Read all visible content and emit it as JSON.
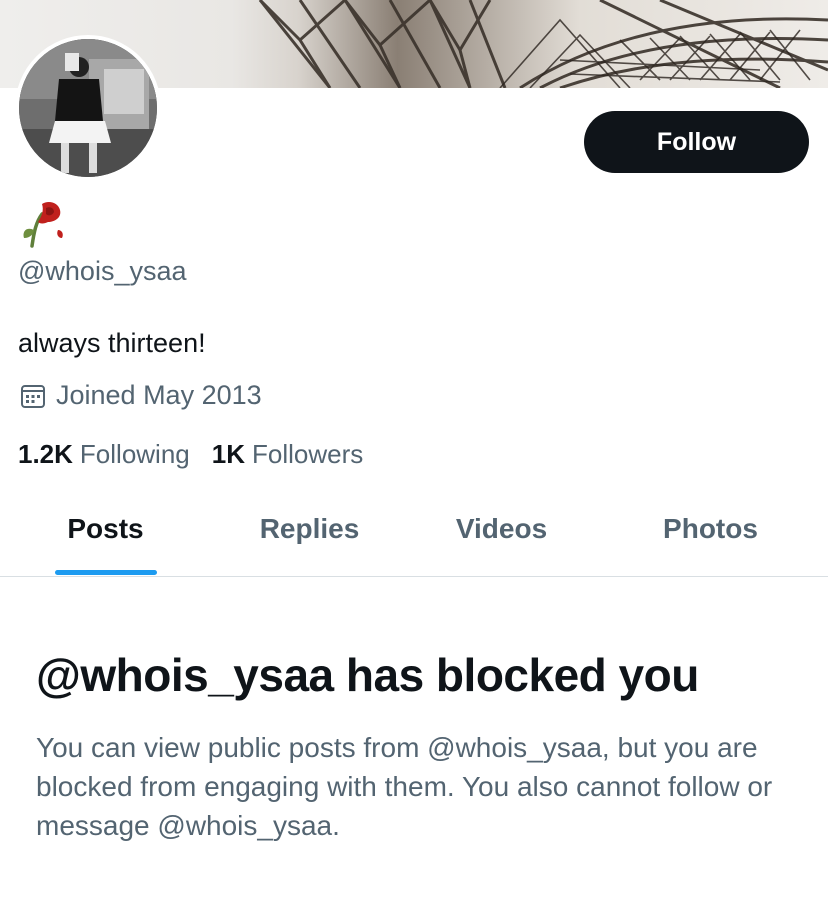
{
  "profile": {
    "handle": "@whois_ysaa",
    "bio": "always thirteen!",
    "joined": "Joined May 2013",
    "name_emoji": "wilted-rose-icon"
  },
  "stats": {
    "following_count": "1.2K",
    "following_label": "Following",
    "followers_count": "1K",
    "followers_label": "Followers"
  },
  "actions": {
    "follow_label": "Follow"
  },
  "tabs": [
    {
      "label": "Posts",
      "active": true
    },
    {
      "label": "Replies",
      "active": false
    },
    {
      "label": "Videos",
      "active": false
    },
    {
      "label": "Photos",
      "active": false
    }
  ],
  "blocked": {
    "title": "@whois_ysaa has blocked you",
    "message": "You can view public posts from @whois_ysaa, but you are blocked from engaging with them. You also cannot follow or message @whois_ysaa."
  },
  "colors": {
    "text_primary": "#0f1419",
    "text_secondary": "#536471",
    "accent": "#1d9bf0",
    "button_bg": "#0f1419",
    "divider": "#d9dfe3"
  }
}
